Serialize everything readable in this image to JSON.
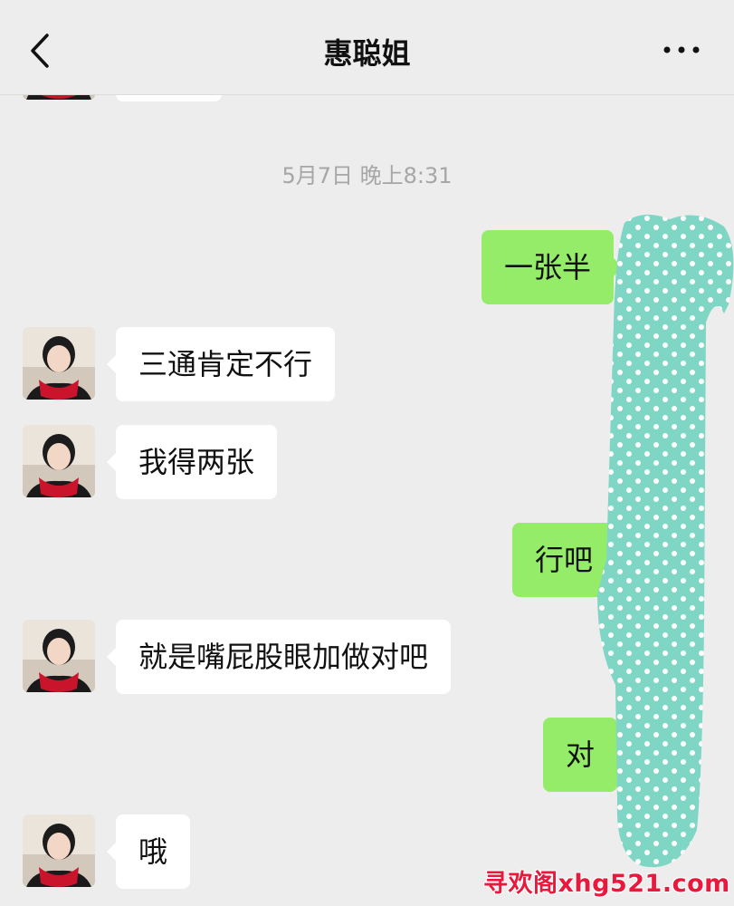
{
  "header": {
    "title": "惠聪姐",
    "back_icon": "chevron-left-icon",
    "more_icon": "ellipsis-icon"
  },
  "timestamp": "5月7日 晚上8:31",
  "messages": [
    {
      "side": "out",
      "text": "一张半"
    },
    {
      "side": "in",
      "text": "三通肯定不行"
    },
    {
      "side": "in",
      "text": "我得两张"
    },
    {
      "side": "out",
      "text": "行吧"
    },
    {
      "side": "in",
      "text": "就是嘴屁股眼加做对吧"
    },
    {
      "side": "out",
      "text": "对"
    },
    {
      "side": "in",
      "text": "哦"
    }
  ],
  "watermark": "寻欢阁xhg521.com",
  "colors": {
    "background": "#ededed",
    "outgoing_bubble": "#95ec69",
    "incoming_bubble": "#ffffff",
    "censor_overlay": "#7fd6c4",
    "watermark": "#e8193c"
  }
}
